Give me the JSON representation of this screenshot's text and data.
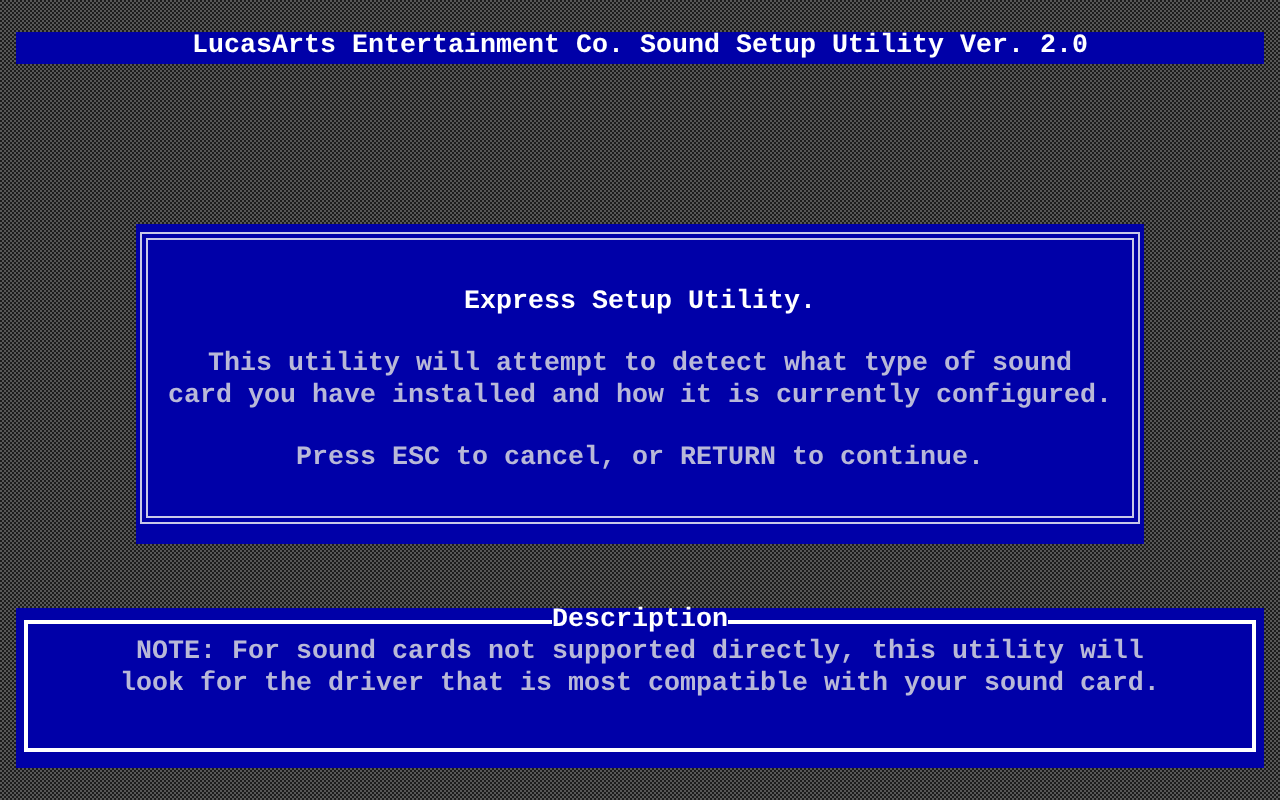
{
  "title_bar": {
    "title": "LucasArts Entertainment Co. Sound Setup Utility Ver. 2.0"
  },
  "dialog": {
    "heading": "Express Setup Utility.",
    "message": "This utility will attempt to detect what type of sound\ncard you have installed and how it is currently configured.",
    "prompt": "Press ESC to cancel, or RETURN to continue."
  },
  "description": {
    "title": "Description",
    "text": "NOTE: For sound cards not supported directly, this utility will\nlook for the driver that is most compatible with your sound card."
  }
}
